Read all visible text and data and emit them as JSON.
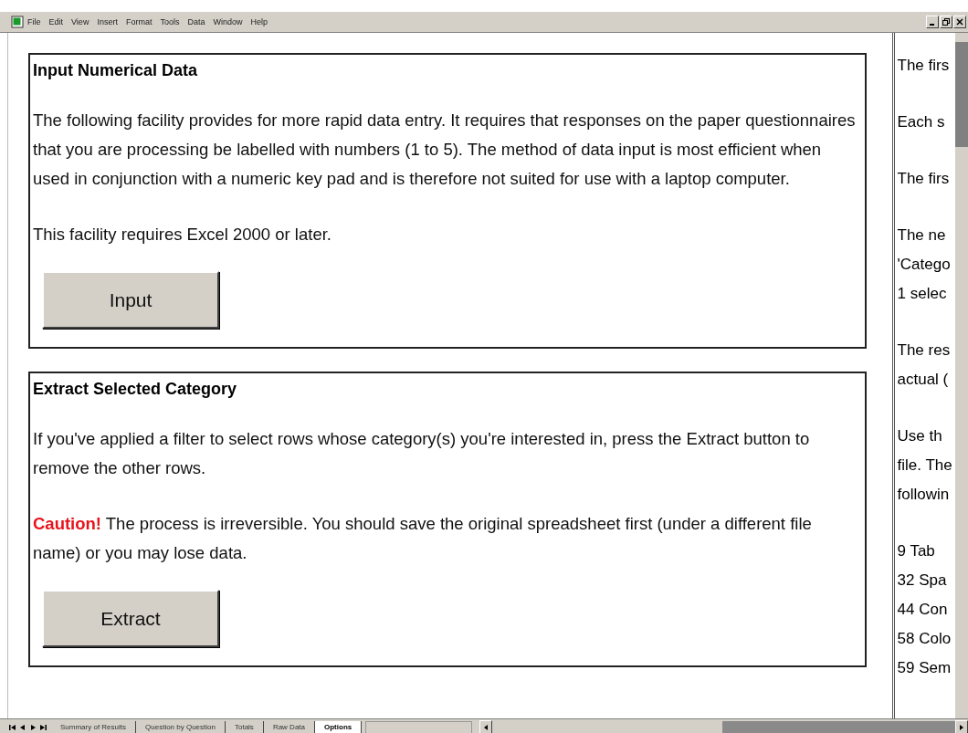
{
  "menu_bar": [
    "File",
    "Edit",
    "View",
    "Insert",
    "Format",
    "Tools",
    "Data",
    "Window",
    "Help"
  ],
  "sections": [
    {
      "title": "Input Numerical Data",
      "paragraphs": [
        {
          "kind": "plain",
          "text": "The following facility provides for more rapid data entry. It requires that responses on the paper questionnaires that you are processing be labelled with numbers (1 to 5). The method of data input is most efficient when used in conjunction with a numeric key pad and is therefore not suited for use with a laptop computer."
        },
        {
          "kind": "plain",
          "text": "This facility requires Excel 2000 or later."
        }
      ],
      "button": "Input"
    },
    {
      "title": "Extract Selected Category",
      "paragraphs": [
        {
          "kind": "plain",
          "text": "If you've applied a filter to select rows whose category(s) you're interested in, press the Extract button to remove the other rows."
        },
        {
          "kind": "caution",
          "text": "**Caution!** The process is irreversible. You should save the original spreadsheet first (under a different file name) or you may lose data."
        }
      ],
      "button": "Extract"
    }
  ],
  "side_pane": [
    [
      "The firs"
    ],
    [
      "Each s"
    ],
    [
      "The firs"
    ],
    [
      "The ne",
      "'Catego",
      "1 selec"
    ],
    [
      "The res",
      "actual ("
    ],
    [
      "Use th",
      "file. The",
      "followin"
    ],
    [
      "9 Tab",
      "32 Spa",
      "44 Con",
      "58 Colo",
      "59 Sem"
    ]
  ],
  "sheet_tabs": [
    {
      "label": "Summary of Results",
      "selected": false
    },
    {
      "label": "Question by Question",
      "selected": false
    },
    {
      "label": "Totals",
      "selected": false
    },
    {
      "label": "Raw Data",
      "selected": false
    },
    {
      "label": "Options",
      "selected": true
    }
  ]
}
